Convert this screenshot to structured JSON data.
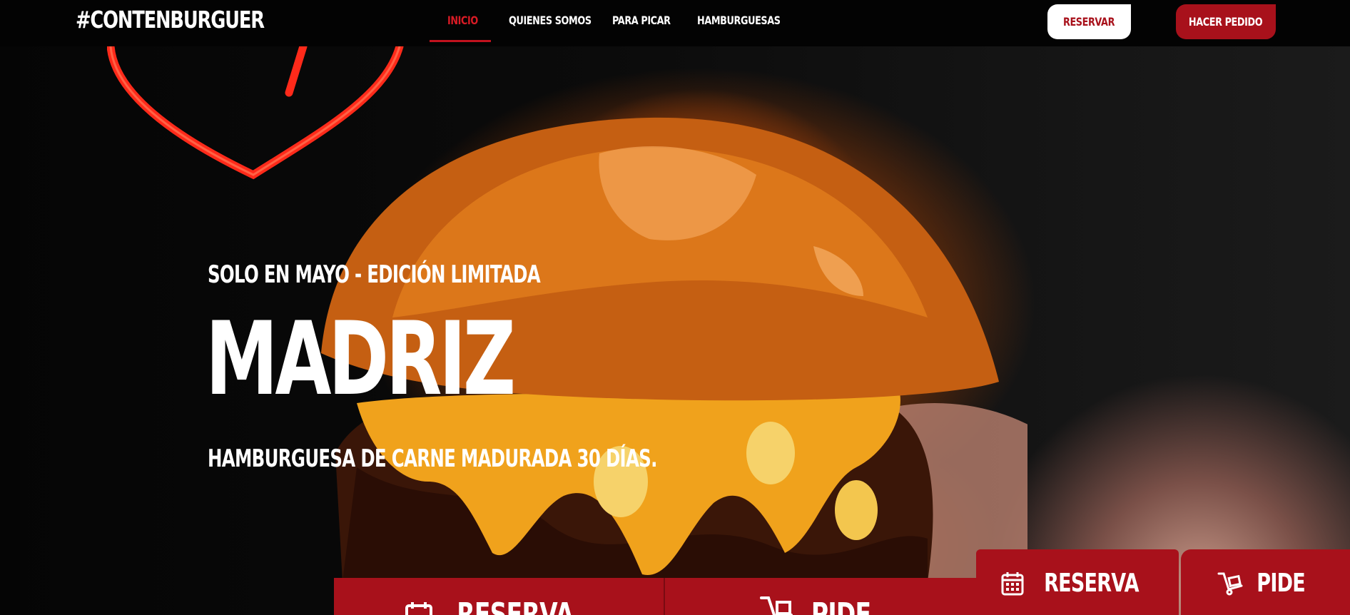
{
  "header": {
    "logo": "#CONTENBURGUER",
    "nav": [
      {
        "label": "INICIO",
        "active": true
      },
      {
        "label": "QUIENES SOMOS",
        "active": false
      },
      {
        "label": "PARA PICAR",
        "active": false
      },
      {
        "label": "HAMBURGUESAS",
        "active": false
      }
    ],
    "reservar_label": "RESERVAR",
    "hacer_pedido_label": "HACER PEDIDO"
  },
  "hero": {
    "subtitle": "SOLO EN MAYO - EDICIÓN LIMITADA",
    "title": "MADRIZ",
    "tagline": "HAMBURGUESA DE CARNE MADURADA 30 DÍAS."
  },
  "bottom_bar": {
    "reserva_label": "RESERVA",
    "pide_label": "PIDE"
  },
  "floating": {
    "reserva_label": "RESERVA",
    "pide_label": "PIDE"
  },
  "colors": {
    "brand_red": "#a8111b",
    "active_nav": "#d91b25",
    "neon": "#ff2a1a"
  },
  "icons": {
    "reserva": "calendar-icon",
    "pide": "delivery-cart-icon"
  }
}
